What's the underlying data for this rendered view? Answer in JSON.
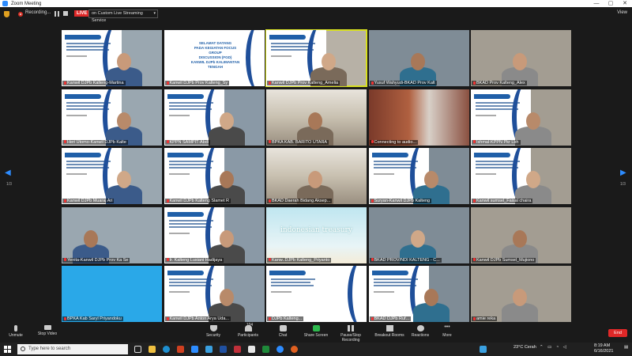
{
  "window": {
    "title": "Zoom Meeting",
    "controls": [
      "—",
      "▢",
      "✕"
    ]
  },
  "topbar": {
    "recording_label": "Recording...",
    "live_badge": "LIVE",
    "stream_label": "on Custom Live Streaming Service",
    "view_label": "View"
  },
  "pager": {
    "left": "1/3",
    "right": "1/3"
  },
  "participants": [
    {
      "name": "Kanwil DJPb Kalteng-Martina"
    },
    {
      "name": "Kanwil DJPb Prov Kalteng_Sy"
    },
    {
      "name": "Kanwil DJPb Prov Kalteng_Amelia"
    },
    {
      "name": "Yusuf Wahyudi-BKAD Prov Kalt"
    },
    {
      "name": "BKAD Prov Kalteng_Alex"
    },
    {
      "name": "Heri Utomo-Kanwil DJPb Kalte"
    },
    {
      "name": "KPPN SAMPIT-Abdi"
    },
    {
      "name": "BPKA KAB. BARITO UTARA"
    },
    {
      "name": "Connecting to audio..."
    },
    {
      "name": "Ishmal-KPPN Pkr Lbh"
    },
    {
      "name": "Kanwil DJPb Muaraj Ari"
    },
    {
      "name": "Kanwil DJPb Kalteng Slamet R"
    },
    {
      "name": "BKAD Daerah Bidang Aksep..."
    },
    {
      "name": "Suryan-Kanwil DJPb Kalteng"
    },
    {
      "name": "Kanwil sumsel_Faisal chaira"
    },
    {
      "name": "Yenita-Kanwil DJPb Prov Ka Se"
    },
    {
      "name": "Ir. Kalteng Lusiani Hadijaya"
    },
    {
      "name": "Kanw..DJPb Kalteng_Priyanto"
    },
    {
      "name": "BKAD PROV/NDI KALTENG - C..."
    },
    {
      "name": "Kanwil DJPb Sumsel_Mujiono"
    },
    {
      "name": "BPKA Kab Saryl Priyandoku"
    },
    {
      "name": "Kanwil DJPb Anton Arya Uda..."
    },
    {
      "name": "DJPb Kalteng..."
    },
    {
      "name": "BKAD DJPb Ruf..."
    },
    {
      "name": "amie reka"
    }
  ],
  "slide_banner": "indonesian treasury",
  "welcome_slide": {
    "line1": "SELAMAT DATANG",
    "line2": "PADA KEGIATAN FOCUS GROUP",
    "line3": "DISCUSSION (FGD)",
    "line4": "KANWIL DJPb KALIMANTAN TENGAH"
  },
  "toolbar": {
    "unmute": "Unmute",
    "stop_video": "Stop Video",
    "security": "Security",
    "participants": "Participants",
    "participants_count": "104",
    "chat": "Chat",
    "share_screen": "Share Screen",
    "pause_recording": "Pause/Stop Recording",
    "breakout": "Breakout Rooms",
    "reactions": "Reactions",
    "more": "More",
    "end": "End"
  },
  "taskbar": {
    "search_placeholder": "Type here to search",
    "weather": "23°C  Cerah",
    "time": "8:19 AM",
    "date": "6/16/2021"
  },
  "colors": {
    "accent": "#2d8cff",
    "live": "#e02828",
    "slide_blue": "#1f5fa8"
  }
}
